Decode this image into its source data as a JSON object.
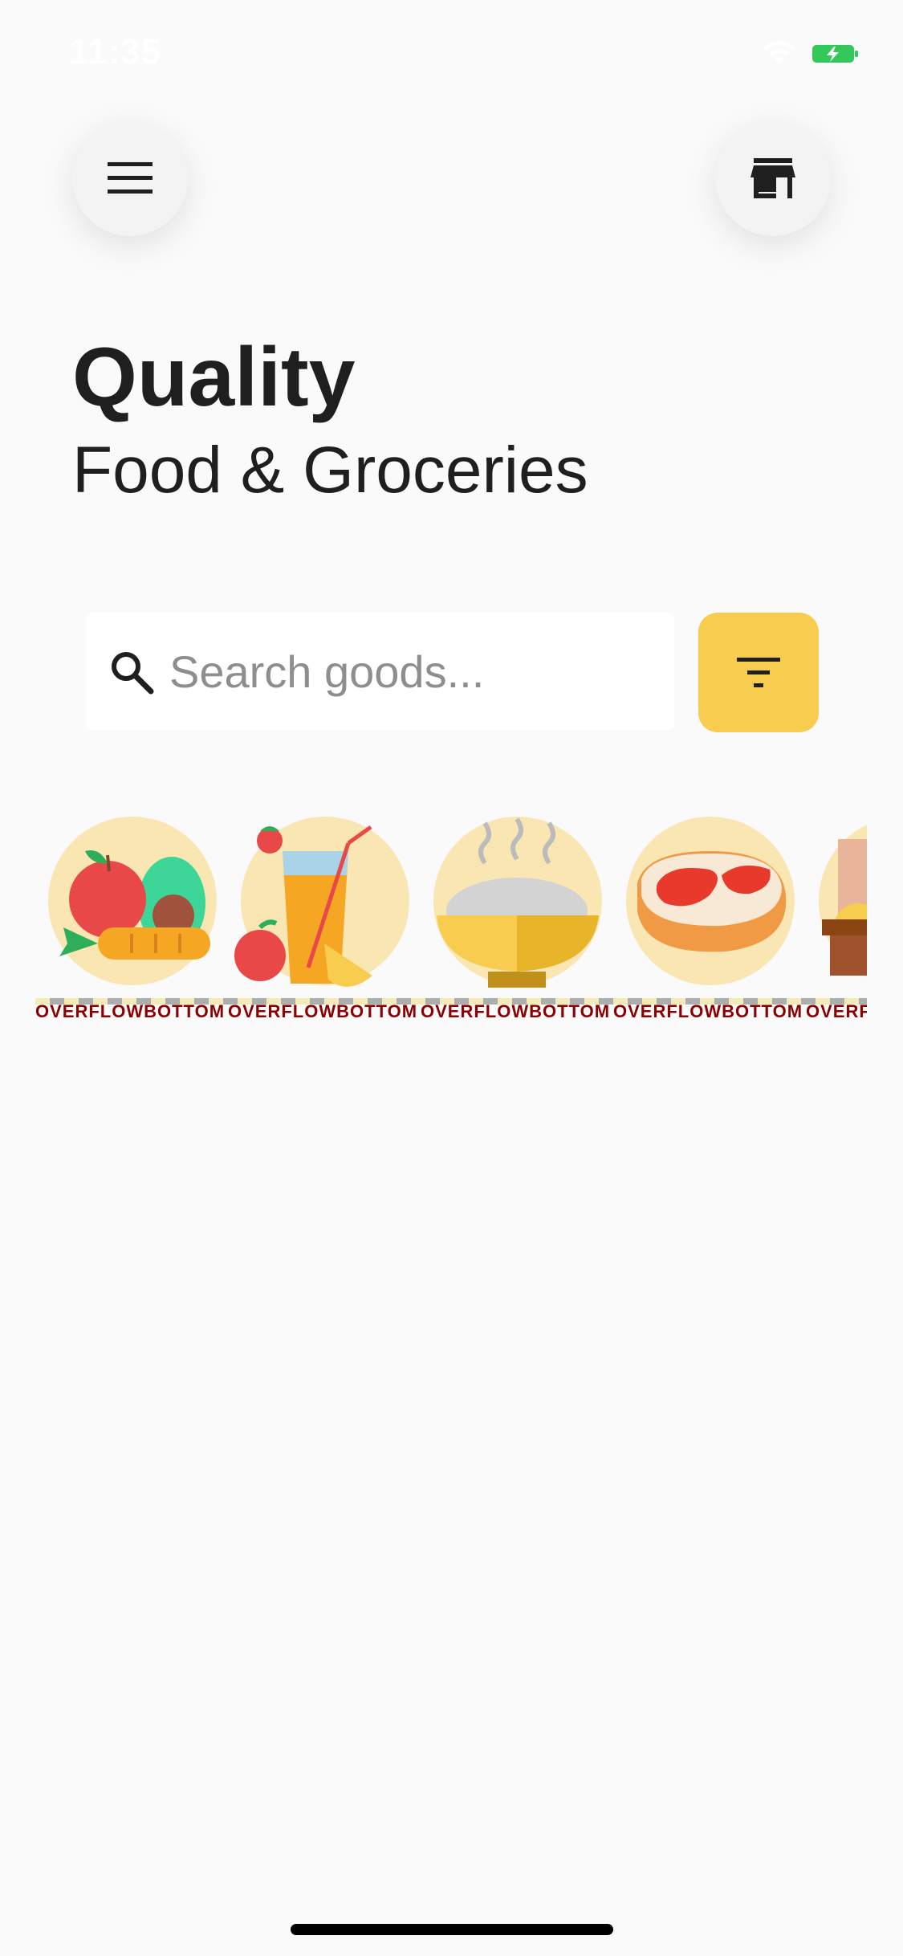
{
  "status_bar": {
    "time": "11:35",
    "wifi_icon": "wifi-icon",
    "battery_icon": "battery-charging-icon",
    "battery_color": "#34c759"
  },
  "header": {
    "menu_icon": "hamburger-menu-icon",
    "store_icon": "store-icon"
  },
  "hero": {
    "title": "Quality",
    "subtitle": "Food & Groceries"
  },
  "search": {
    "placeholder": "Search goods...",
    "value": "",
    "icon": "search-icon"
  },
  "filter": {
    "icon": "filter-icon",
    "color": "#f8cd4f"
  },
  "categories": [
    {
      "icon": "fruits-vegetables-icon",
      "overflow_text": "OVERFLOWBOTTOM"
    },
    {
      "icon": "juice-drinks-icon",
      "overflow_text": "OVERFLOWBOTTOM"
    },
    {
      "icon": "rice-bowl-icon",
      "overflow_text": "OVERFLOWBOTTOM"
    },
    {
      "icon": "meat-steak-icon",
      "overflow_text": "OVERFLOWBOTTOM"
    },
    {
      "icon": "bakery-icon",
      "overflow_text": "OVERF"
    }
  ]
}
